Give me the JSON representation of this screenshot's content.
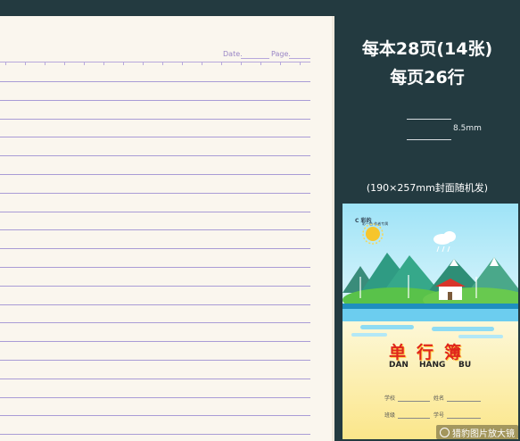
{
  "notebook_page": {
    "date_label": "Date.",
    "page_label": "Page.",
    "line_color": "#a99cd6",
    "paper_color": "#faf6ee"
  },
  "specs": {
    "line1": "每本28页(14张)",
    "line2": "每页26行",
    "line_spacing": "8.5mm",
    "cover_note": "(190×257mm封面随机发)"
  },
  "cover": {
    "brand": "C 彩的",
    "brand_sub": "彩一色 作者专属",
    "title_cn": "单行簿",
    "pinyin": [
      "DAN",
      "HANG",
      "BU"
    ],
    "fields": [
      {
        "label": "学校"
      },
      {
        "label": "姓名"
      },
      {
        "label": "班级"
      },
      {
        "label": "学号"
      }
    ]
  },
  "watermark": {
    "text": "猎豹图片放大镜"
  },
  "colors": {
    "background": "#233a40",
    "title_red": "#e0261b"
  }
}
